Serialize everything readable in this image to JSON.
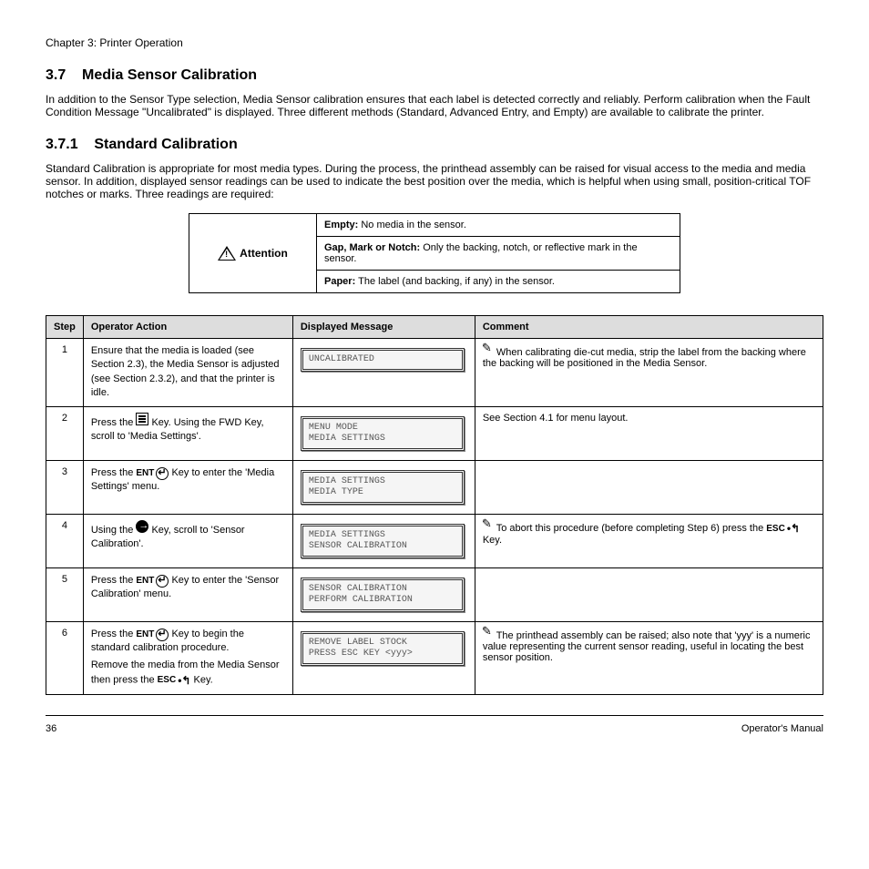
{
  "header_title": "Chapter 3: Printer Operation",
  "section_number": "3.7",
  "section_title": "Media Sensor Calibration",
  "intro": "In addition to the Sensor Type selection, Media Sensor calibration ensures that each label is detected correctly and reliably. Perform calibration when the Fault Condition Message \"Uncalibrated\" is displayed. Three different methods (Standard, Advanced Entry, and Empty) are available to calibrate the printer.",
  "sub_number": "3.7.1",
  "sub_title": "Standard Calibration",
  "sub_intro": "Standard Calibration is appropriate for most media types. During the process, the printhead assembly can be raised for visual access to the media and media sensor. In addition, displayed sensor readings can be used to indicate the best position over the media, which is helpful when using small, position-critical TOF notches or marks. Three readings are required:",
  "attention": {
    "attn_label": "Attention",
    "row1_left": "Empty:",
    "row1_right": "No media in the sensor.",
    "row2_left": "Gap, Mark or Notch:",
    "row2_right": "Only the backing, notch, or reflective mark in the sensor.",
    "row3_left": "Paper:",
    "row3_right": "The label (and backing, if any) in the sensor."
  },
  "table_head": {
    "step": "Step",
    "operator": "Operator Action",
    "display": "Displayed Message",
    "comment": "Comment"
  },
  "rows": [
    {
      "step": "1",
      "op_html": "Ensure that the media is loaded (see Section 2.3), the Media Sensor is adjusted (see Section 2.3.2), and that the printer is idle.",
      "lcd_lines": [
        "UNCALIBRATED"
      ],
      "comment": "When calibrating die-cut media, strip the label from the backing where the backing will be positioned in the Media Sensor."
    },
    {
      "step": "2",
      "op_icon": "menu",
      "op_text_before": "Press the ",
      "op_text_after": " Key.\nUsing the FWD Key, scroll to 'Media Settings'.",
      "lcd_lines": [
        "MENU MODE",
        "MEDIA SETTINGS"
      ],
      "comment": "See Section 4.1 for menu layout."
    },
    {
      "step": "3",
      "op_icon": "ent",
      "op_text_before": "Press the ",
      "op_text_after": " Key to enter the 'Media Settings' menu.",
      "lcd_lines": [
        "MEDIA SETTINGS",
        "MEDIA TYPE"
      ],
      "comment": ""
    },
    {
      "step": "4",
      "op_icon": "fwd",
      "op_text_before": "Using the ",
      "op_text_after": " Key, scroll to 'Sensor Calibration'.",
      "lcd_lines": [
        "MEDIA SETTINGS",
        "SENSOR CALIBRATION"
      ],
      "comment_pre": "To abort this procedure (before completing Step 6) press the ",
      "comment_icon": "esc",
      "comment_post": " Key."
    },
    {
      "step": "5",
      "op_icon": "ent",
      "op_text_before": "Press the ",
      "op_text_after": " Key to enter the 'Sensor Calibration' menu.",
      "lcd_lines": [
        "SENSOR CALIBRATION",
        "PERFORM CALIBRATION"
      ],
      "comment": ""
    },
    {
      "step": "6",
      "op_icon": "ent",
      "op_text_before": "Press the ",
      "op_text_after": " Key to begin the standard calibration procedure.",
      "op_extra_pre": "Remove the media from the Media Sensor then press the ",
      "op_extra_icon": "esc",
      "op_extra_post": " Key.",
      "lcd_lines": [
        "REMOVE LABEL STOCK",
        "PRESS ESC KEY <yyy>"
      ],
      "comment": "The printhead assembly can be raised; also note that 'yyy' is a numeric value representing the current sensor reading, useful in locating the best sensor position."
    }
  ],
  "footer_page": "36",
  "footer_right": "Operator's Manual"
}
